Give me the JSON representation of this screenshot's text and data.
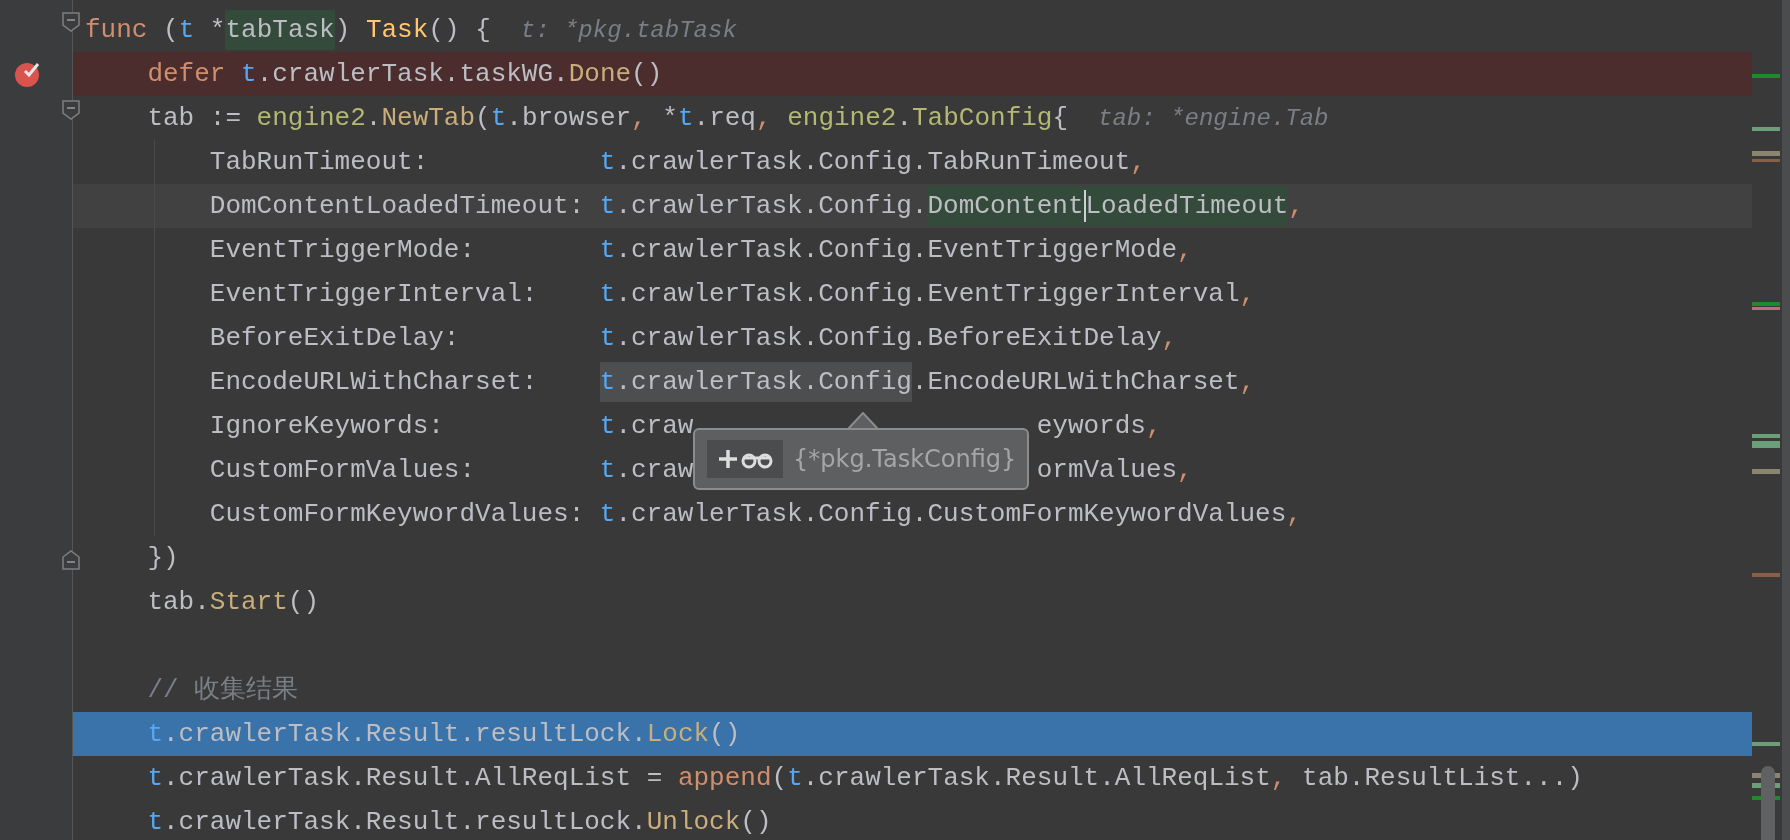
{
  "editor": {
    "lines": [
      {
        "kind": "plain",
        "fold_start": true,
        "tokens": [
          {
            "t": "func",
            "kind": "keyword"
          },
          {
            "t": " (",
            "kind": "plain"
          },
          {
            "t": "t",
            "kind": "param"
          },
          {
            "t": " *",
            "kind": "plain"
          },
          {
            "t": "tabTask",
            "kind": "plain",
            "highlighted": true
          },
          {
            "t": ") ",
            "kind": "plain"
          },
          {
            "t": "Task",
            "kind": "func"
          },
          {
            "t": "() {",
            "kind": "plain"
          }
        ],
        "hint": "t: *pkg.tabTask",
        "children": [
          {
            "kind": "breakpoint",
            "tokens": [
              {
                "t": "defer ",
                "kind": "keyword"
              },
              {
                "t": "t",
                "kind": "param"
              },
              {
                "t": ".crawlerTask.taskWG.",
                "kind": "plain"
              },
              {
                "t": "Done",
                "kind": "call"
              },
              {
                "t": "()",
                "kind": "plain"
              }
            ]
          },
          {
            "kind": "plain",
            "fold_start": true,
            "tokens": [
              {
                "t": "tab := ",
                "kind": "plain"
              },
              {
                "t": "engine2",
                "kind": "pkg"
              },
              {
                "t": ".",
                "kind": "plain"
              },
              {
                "t": "NewTab",
                "kind": "call"
              },
              {
                "t": "(",
                "kind": "plain"
              },
              {
                "t": "t",
                "kind": "param"
              },
              {
                "t": ".browser",
                "kind": "plain"
              },
              {
                "t": ", ",
                "kind": "comma"
              },
              {
                "t": "*",
                "kind": "plain"
              },
              {
                "t": "t",
                "kind": "param"
              },
              {
                "t": ".req",
                "kind": "plain"
              },
              {
                "t": ", ",
                "kind": "comma"
              },
              {
                "t": "engine2",
                "kind": "pkg"
              },
              {
                "t": ".",
                "kind": "plain"
              },
              {
                "t": "TabConfig",
                "kind": "pkg"
              },
              {
                "t": "{",
                "kind": "plain"
              }
            ],
            "hint": "tab: *engine.Tab",
            "children": [
              {
                "kind": "plain",
                "key": "TabRunTimeout:",
                "tokens": [
                  {
                    "t": "t",
                    "kind": "param"
                  },
                  {
                    "t": ".crawlerTask.Config.TabRunTimeout",
                    "kind": "plain"
                  },
                  {
                    "t": ",",
                    "kind": "comma"
                  }
                ]
              },
              {
                "kind": "current",
                "key": "DomContentLoadedTimeout:",
                "tokens": [
                  {
                    "t": "t",
                    "kind": "param"
                  },
                  {
                    "t": ".crawlerTask.Config.",
                    "kind": "plain"
                  },
                  {
                    "t": "DomContent",
                    "kind": "plain",
                    "highlighted": true,
                    "caret_after": true
                  },
                  {
                    "t": "LoadedTimeout",
                    "kind": "plain",
                    "highlighted": true
                  },
                  {
                    "t": ",",
                    "kind": "comma"
                  }
                ]
              },
              {
                "kind": "plain",
                "key": "EventTriggerMode:",
                "tokens": [
                  {
                    "t": "t",
                    "kind": "param"
                  },
                  {
                    "t": ".crawlerTask.Config.EventTriggerMode",
                    "kind": "plain"
                  },
                  {
                    "t": ",",
                    "kind": "comma"
                  }
                ]
              },
              {
                "kind": "plain",
                "key": "EventTriggerInterval:",
                "tokens": [
                  {
                    "t": "t",
                    "kind": "param"
                  },
                  {
                    "t": ".crawlerTask.Config.EventTriggerInterval",
                    "kind": "plain"
                  },
                  {
                    "t": ",",
                    "kind": "comma"
                  }
                ]
              },
              {
                "kind": "plain",
                "key": "BeforeExitDelay:",
                "tokens": [
                  {
                    "t": "t",
                    "kind": "param"
                  },
                  {
                    "t": ".crawlerTask.Config.BeforeExitDelay",
                    "kind": "plain"
                  },
                  {
                    "t": ",",
                    "kind": "comma"
                  }
                ]
              },
              {
                "kind": "plain",
                "key": "EncodeURLWithCharset:",
                "tokens": [
                  {
                    "t": "t",
                    "kind": "param",
                    "selected": true
                  },
                  {
                    "t": ".crawlerTask.Config",
                    "kind": "plain",
                    "selected": true
                  },
                  {
                    "t": ".EncodeURLWithCharset",
                    "kind": "plain"
                  },
                  {
                    "t": ",",
                    "kind": "comma"
                  }
                ],
                "tooltip": {
                  "text": "{*pkg.TaskConfig}"
                }
              },
              {
                "kind": "plain",
                "key": "IgnoreKeywords:",
                "tokens": [
                  {
                    "t": "t",
                    "kind": "param"
                  },
                  {
                    "t": ".craw",
                    "kind": "plain"
                  },
                  {
                    "kind": "covered"
                  },
                  {
                    "t": "eywords",
                    "kind": "plain"
                  },
                  {
                    "t": ",",
                    "kind": "comma"
                  }
                ]
              },
              {
                "kind": "plain",
                "key": "CustomFormValues:",
                "tokens": [
                  {
                    "t": "t",
                    "kind": "param"
                  },
                  {
                    "t": ".craw",
                    "kind": "plain"
                  },
                  {
                    "kind": "covered"
                  },
                  {
                    "t": "ormValues",
                    "kind": "plain"
                  },
                  {
                    "t": ",",
                    "kind": "comma"
                  }
                ]
              },
              {
                "kind": "plain",
                "key": "CustomFormKeywordValues:",
                "tokens": [
                  {
                    "t": "t",
                    "kind": "param"
                  },
                  {
                    "t": ".crawlerTask.Config.CustomFormKeywordValues",
                    "kind": "plain"
                  },
                  {
                    "t": ",",
                    "kind": "comma"
                  }
                ]
              }
            ]
          },
          {
            "kind": "plain",
            "fold_end": true,
            "tokens": [
              {
                "t": "})",
                "kind": "plain"
              }
            ]
          },
          {
            "kind": "plain",
            "tokens": [
              {
                "t": "tab.",
                "kind": "plain"
              },
              {
                "t": "Start",
                "kind": "call"
              },
              {
                "t": "()",
                "kind": "plain"
              }
            ]
          },
          {
            "kind": "blank"
          },
          {
            "kind": "plain",
            "tokens": [
              {
                "t": "// 收集结果",
                "kind": "comment"
              }
            ]
          },
          {
            "kind": "execution",
            "tokens": [
              {
                "t": "t",
                "kind": "param"
              },
              {
                "t": ".crawlerTask.Result.resultLock.",
                "kind": "plain"
              },
              {
                "t": "Lock",
                "kind": "call"
              },
              {
                "t": "()",
                "kind": "plain"
              }
            ]
          },
          {
            "kind": "plain",
            "tokens": [
              {
                "t": "t",
                "kind": "param"
              },
              {
                "t": ".crawlerTask.Result.AllReqList = ",
                "kind": "plain"
              },
              {
                "t": "append",
                "kind": "keyword"
              },
              {
                "t": "(",
                "kind": "plain"
              },
              {
                "t": "t",
                "kind": "param"
              },
              {
                "t": ".crawlerTask.Result.AllReqList",
                "kind": "plain"
              },
              {
                "t": ", ",
                "kind": "comma"
              },
              {
                "t": "tab.ResultList...)",
                "kind": "plain"
              }
            ]
          },
          {
            "kind": "plain",
            "tokens": [
              {
                "t": "t",
                "kind": "param"
              },
              {
                "t": ".crawlerTask.Result.resultLock.",
                "kind": "plain"
              },
              {
                "t": "Unlock",
                "kind": "call"
              },
              {
                "t": "()",
                "kind": "plain"
              }
            ]
          }
        ]
      }
    ]
  }
}
